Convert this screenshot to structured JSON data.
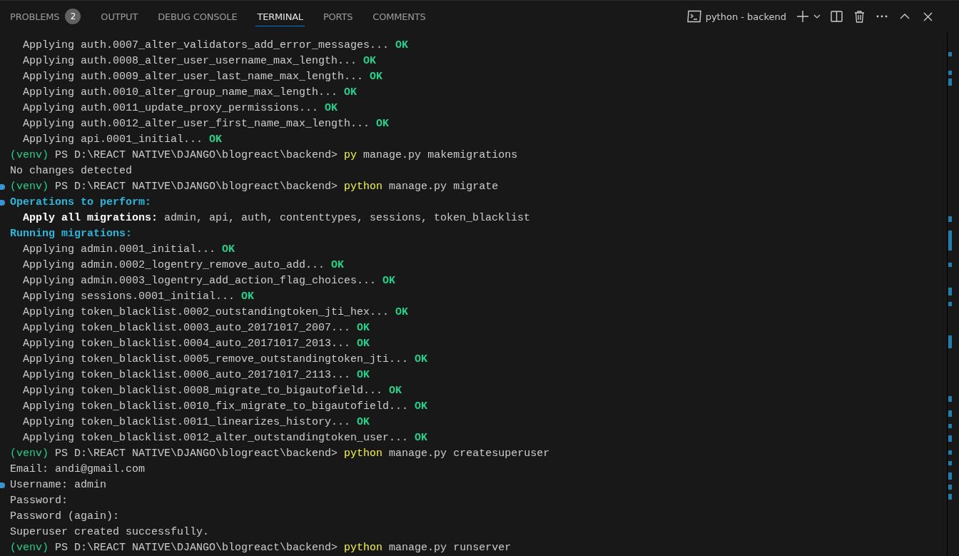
{
  "panel_tabs": [
    {
      "label": "PROBLEMS",
      "badge": "2",
      "selected": false
    },
    {
      "label": "OUTPUT",
      "selected": false
    },
    {
      "label": "DEBUG CONSOLE",
      "selected": false
    },
    {
      "label": "TERMINAL",
      "selected": true
    },
    {
      "label": "PORTS",
      "selected": false
    },
    {
      "label": "COMMENTS",
      "selected": false
    }
  ],
  "terminal_selector": {
    "label": "python - backend"
  },
  "terminal_lines": [
    {
      "indented": true,
      "marked": false,
      "segments": [
        {
          "kind": "plain",
          "text": "Applying auth.0007_alter_validators_add_error_messages... "
        },
        {
          "kind": "ok",
          "text": "OK"
        }
      ]
    },
    {
      "indented": true,
      "marked": false,
      "segments": [
        {
          "kind": "plain",
          "text": "Applying auth.0008_alter_user_username_max_length... "
        },
        {
          "kind": "ok",
          "text": "OK"
        }
      ]
    },
    {
      "indented": true,
      "marked": false,
      "segments": [
        {
          "kind": "plain",
          "text": "Applying auth.0009_alter_user_last_name_max_length... "
        },
        {
          "kind": "ok",
          "text": "OK"
        }
      ]
    },
    {
      "indented": true,
      "marked": false,
      "segments": [
        {
          "kind": "plain",
          "text": "Applying auth.0010_alter_group_name_max_length... "
        },
        {
          "kind": "ok",
          "text": "OK"
        }
      ]
    },
    {
      "indented": true,
      "marked": false,
      "segments": [
        {
          "kind": "plain",
          "text": "Applying auth.0011_update_proxy_permissions... "
        },
        {
          "kind": "ok",
          "text": "OK"
        }
      ]
    },
    {
      "indented": true,
      "marked": false,
      "segments": [
        {
          "kind": "plain",
          "text": "Applying auth.0012_alter_user_first_name_max_length... "
        },
        {
          "kind": "ok",
          "text": "OK"
        }
      ]
    },
    {
      "indented": true,
      "marked": false,
      "segments": [
        {
          "kind": "plain",
          "text": "Applying api.0001_initial... "
        },
        {
          "kind": "ok",
          "text": "OK"
        }
      ]
    },
    {
      "indented": false,
      "marked": false,
      "segments": [
        {
          "kind": "venv",
          "text": "(venv)"
        },
        {
          "kind": "plain",
          "text": " PS D:\\REACT NATIVE\\DJANGO\\blogreact\\backend> "
        },
        {
          "kind": "cmd",
          "text": "py"
        },
        {
          "kind": "plain",
          "text": " manage.py makemigrations"
        }
      ]
    },
    {
      "indented": false,
      "marked": false,
      "segments": [
        {
          "kind": "plain",
          "text": "No changes detected"
        }
      ]
    },
    {
      "indented": false,
      "marked": true,
      "segments": [
        {
          "kind": "venv",
          "text": "(venv)"
        },
        {
          "kind": "plain",
          "text": " PS D:\\REACT NATIVE\\DJANGO\\blogreact\\backend> "
        },
        {
          "kind": "cmd",
          "text": "python"
        },
        {
          "kind": "plain",
          "text": " manage.py migrate"
        }
      ]
    },
    {
      "indented": false,
      "marked": true,
      "segments": [
        {
          "kind": "heading",
          "text": "Operations to perform:"
        }
      ]
    },
    {
      "indented": true,
      "marked": false,
      "segments": [
        {
          "kind": "bold",
          "text": "Apply all migrations:"
        },
        {
          "kind": "plain",
          "text": " admin, api, auth, contenttypes, sessions, token_blacklist"
        }
      ]
    },
    {
      "indented": false,
      "marked": false,
      "segments": [
        {
          "kind": "heading",
          "text": "Running migrations:"
        }
      ]
    },
    {
      "indented": true,
      "marked": false,
      "segments": [
        {
          "kind": "plain",
          "text": "Applying admin.0001_initial... "
        },
        {
          "kind": "ok",
          "text": "OK"
        }
      ]
    },
    {
      "indented": true,
      "marked": false,
      "segments": [
        {
          "kind": "plain",
          "text": "Applying admin.0002_logentry_remove_auto_add... "
        },
        {
          "kind": "ok",
          "text": "OK"
        }
      ]
    },
    {
      "indented": true,
      "marked": false,
      "segments": [
        {
          "kind": "plain",
          "text": "Applying admin.0003_logentry_add_action_flag_choices... "
        },
        {
          "kind": "ok",
          "text": "OK"
        }
      ]
    },
    {
      "indented": true,
      "marked": false,
      "segments": [
        {
          "kind": "plain",
          "text": "Applying sessions.0001_initial... "
        },
        {
          "kind": "ok",
          "text": "OK"
        }
      ]
    },
    {
      "indented": true,
      "marked": false,
      "segments": [
        {
          "kind": "plain",
          "text": "Applying token_blacklist.0002_outstandingtoken_jti_hex... "
        },
        {
          "kind": "ok",
          "text": "OK"
        }
      ]
    },
    {
      "indented": true,
      "marked": false,
      "segments": [
        {
          "kind": "plain",
          "text": "Applying token_blacklist.0003_auto_20171017_2007... "
        },
        {
          "kind": "ok",
          "text": "OK"
        }
      ]
    },
    {
      "indented": true,
      "marked": false,
      "segments": [
        {
          "kind": "plain",
          "text": "Applying token_blacklist.0004_auto_20171017_2013... "
        },
        {
          "kind": "ok",
          "text": "OK"
        }
      ]
    },
    {
      "indented": true,
      "marked": false,
      "segments": [
        {
          "kind": "plain",
          "text": "Applying token_blacklist.0005_remove_outstandingtoken_jti... "
        },
        {
          "kind": "ok",
          "text": "OK"
        }
      ]
    },
    {
      "indented": true,
      "marked": false,
      "segments": [
        {
          "kind": "plain",
          "text": "Applying token_blacklist.0006_auto_20171017_2113... "
        },
        {
          "kind": "ok",
          "text": "OK"
        }
      ]
    },
    {
      "indented": true,
      "marked": false,
      "segments": [
        {
          "kind": "plain",
          "text": "Applying token_blacklist.0008_migrate_to_bigautofield... "
        },
        {
          "kind": "ok",
          "text": "OK"
        }
      ]
    },
    {
      "indented": true,
      "marked": false,
      "segments": [
        {
          "kind": "plain",
          "text": "Applying token_blacklist.0010_fix_migrate_to_bigautofield... "
        },
        {
          "kind": "ok",
          "text": "OK"
        }
      ]
    },
    {
      "indented": true,
      "marked": false,
      "segments": [
        {
          "kind": "plain",
          "text": "Applying token_blacklist.0011_linearizes_history... "
        },
        {
          "kind": "ok",
          "text": "OK"
        }
      ]
    },
    {
      "indented": true,
      "marked": false,
      "segments": [
        {
          "kind": "plain",
          "text": "Applying token_blacklist.0012_alter_outstandingtoken_user... "
        },
        {
          "kind": "ok",
          "text": "OK"
        }
      ]
    },
    {
      "indented": false,
      "marked": false,
      "segments": [
        {
          "kind": "venv",
          "text": "(venv)"
        },
        {
          "kind": "plain",
          "text": " PS D:\\REACT NATIVE\\DJANGO\\blogreact\\backend> "
        },
        {
          "kind": "cmd",
          "text": "python"
        },
        {
          "kind": "plain",
          "text": " manage.py createsuperuser"
        }
      ]
    },
    {
      "indented": false,
      "marked": false,
      "segments": [
        {
          "kind": "plain",
          "text": "Email: andi@gmail.com"
        }
      ]
    },
    {
      "indented": false,
      "marked": true,
      "segments": [
        {
          "kind": "plain",
          "text": "Username: admin"
        }
      ]
    },
    {
      "indented": false,
      "marked": false,
      "segments": [
        {
          "kind": "plain",
          "text": "Password:"
        }
      ]
    },
    {
      "indented": false,
      "marked": false,
      "segments": [
        {
          "kind": "plain",
          "text": "Password (again):"
        }
      ]
    },
    {
      "indented": false,
      "marked": false,
      "segments": [
        {
          "kind": "plain",
          "text": "Superuser created successfully."
        }
      ]
    },
    {
      "indented": false,
      "marked": false,
      "segments": [
        {
          "kind": "venv",
          "text": "(venv)"
        },
        {
          "kind": "plain",
          "text": " PS D:\\REACT NATIVE\\DJANGO\\blogreact\\backend> "
        },
        {
          "kind": "cmd",
          "text": "python"
        },
        {
          "kind": "plain",
          "text": " manage.py runserver"
        }
      ]
    }
  ]
}
